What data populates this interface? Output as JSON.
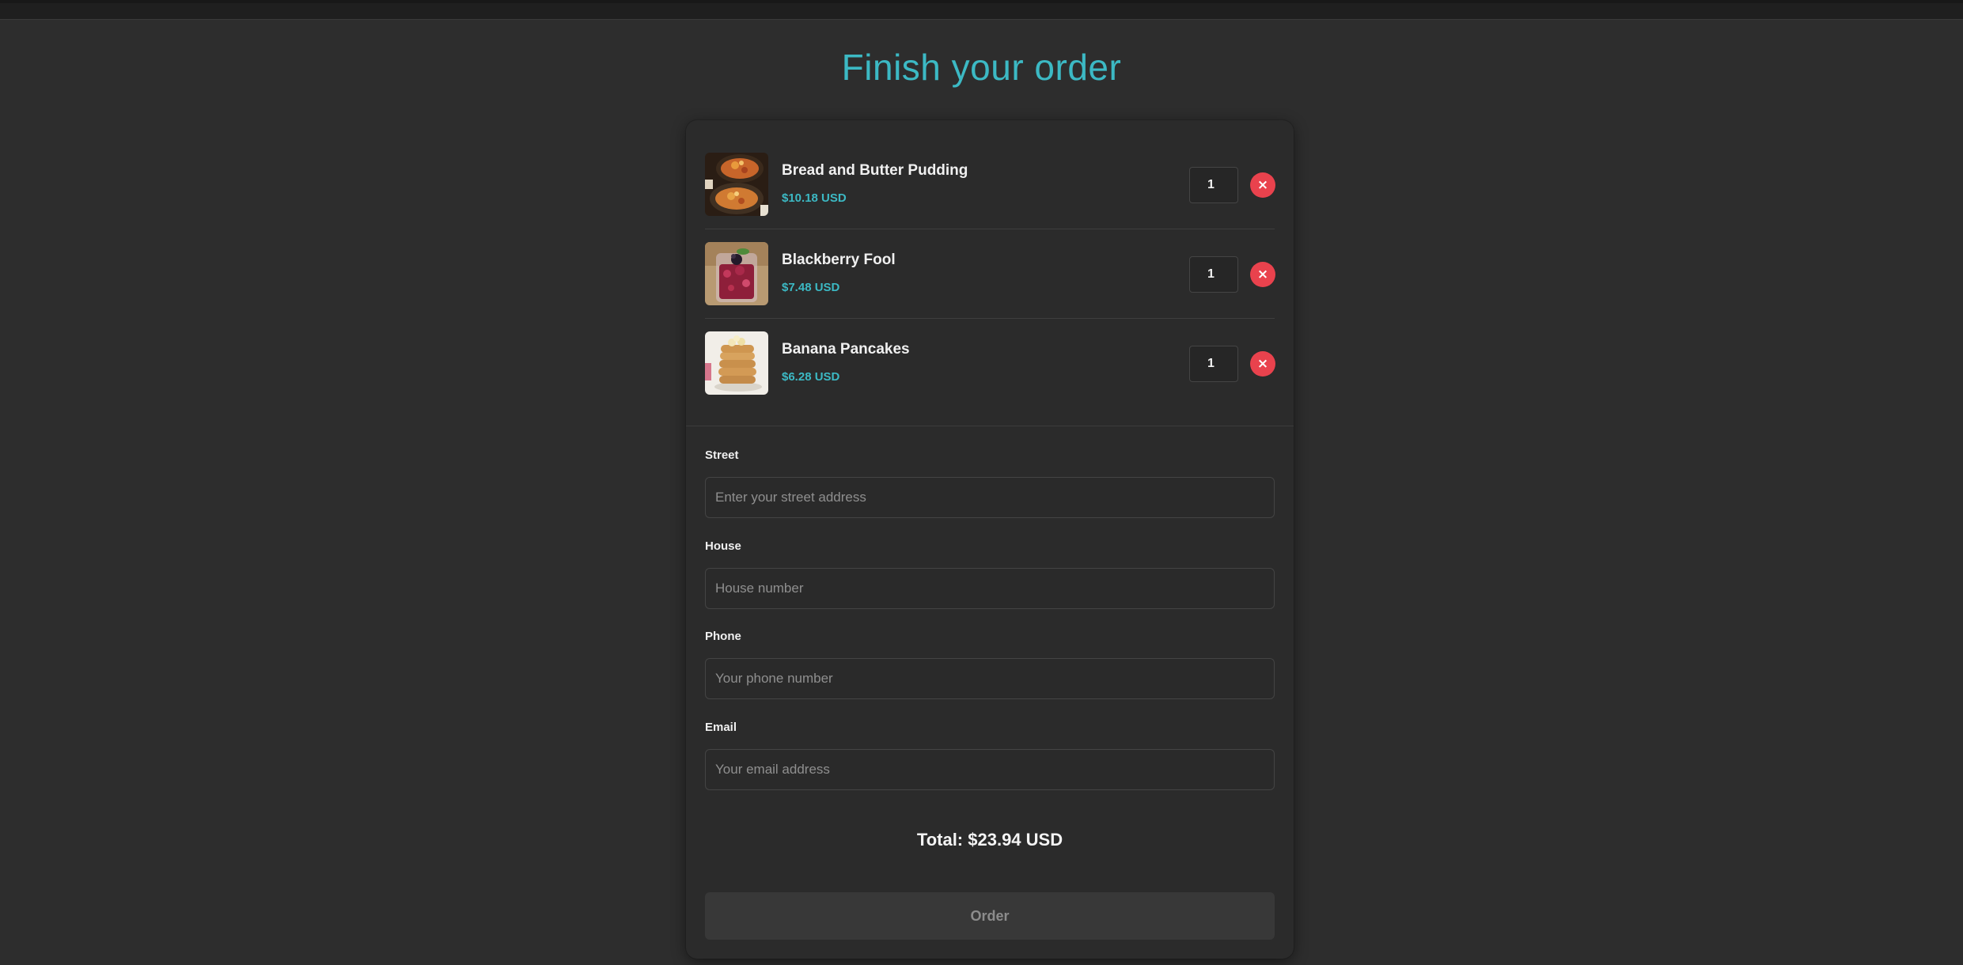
{
  "page": {
    "title": "Finish your order"
  },
  "cart": {
    "items": [
      {
        "name": "Bread and Butter Pudding",
        "price": "$10.18 USD",
        "quantity": "1",
        "remove_label": "×",
        "image": "bread-and-butter-pudding-photo"
      },
      {
        "name": "Blackberry Fool",
        "price": "$7.48 USD",
        "quantity": "1",
        "remove_label": "×",
        "image": "blackberry-fool-photo"
      },
      {
        "name": "Banana Pancakes",
        "price": "$6.28 USD",
        "quantity": "1",
        "remove_label": "×",
        "image": "banana-pancakes-photo"
      }
    ]
  },
  "form": {
    "street": {
      "label": "Street",
      "placeholder": "Enter your street address",
      "value": ""
    },
    "house": {
      "label": "House",
      "placeholder": "House number",
      "value": ""
    },
    "phone": {
      "label": "Phone",
      "placeholder": "Your phone number",
      "value": ""
    },
    "email": {
      "label": "Email",
      "placeholder": "Your email address",
      "value": ""
    }
  },
  "summary": {
    "total": "Total: $23.94 USD"
  },
  "actions": {
    "order_label": "Order"
  },
  "colors": {
    "accent": "#3cb9c4",
    "danger": "#e9424d",
    "background": "#2d2d2d",
    "card": "#2b2b2b"
  }
}
